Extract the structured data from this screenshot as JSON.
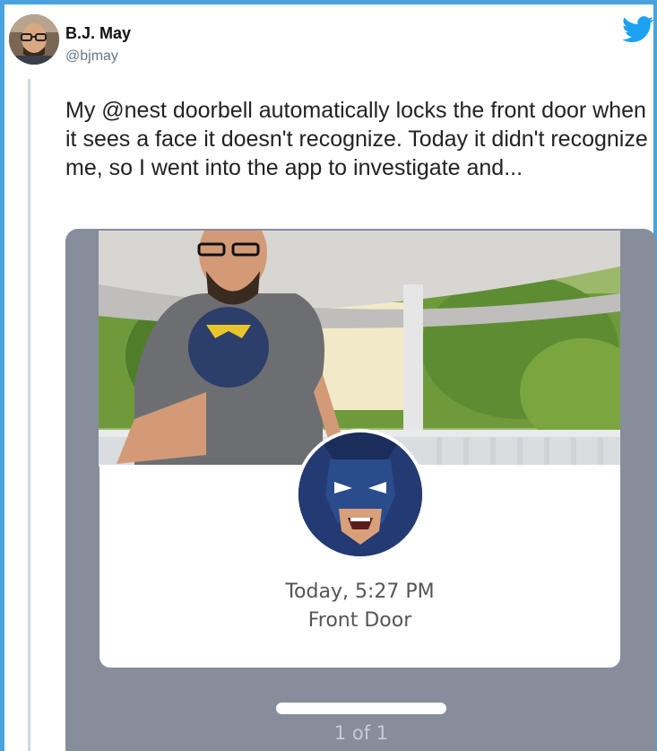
{
  "tweet": {
    "author_name": "B.J. May",
    "author_handle": "@bjmay",
    "text": "My @nest doorbell automatically locks the front door when it sees a face it doesn't recognize. Today it didn't recognize me, so I went into the app to investigate and...",
    "logo_icon": "twitter-bird-icon"
  },
  "media": {
    "photo_icon": "doorbell-camera-snapshot",
    "face_icon": "recognized-face-thumbnail",
    "timestamp": "Today, 5:27 PM",
    "location": "Front Door",
    "pager": "1 of 1"
  },
  "colors": {
    "frame_border": "#4aa3df",
    "twitter_blue": "#1da1f2",
    "media_background": "#888d9c",
    "card_background": "#ffffff"
  }
}
